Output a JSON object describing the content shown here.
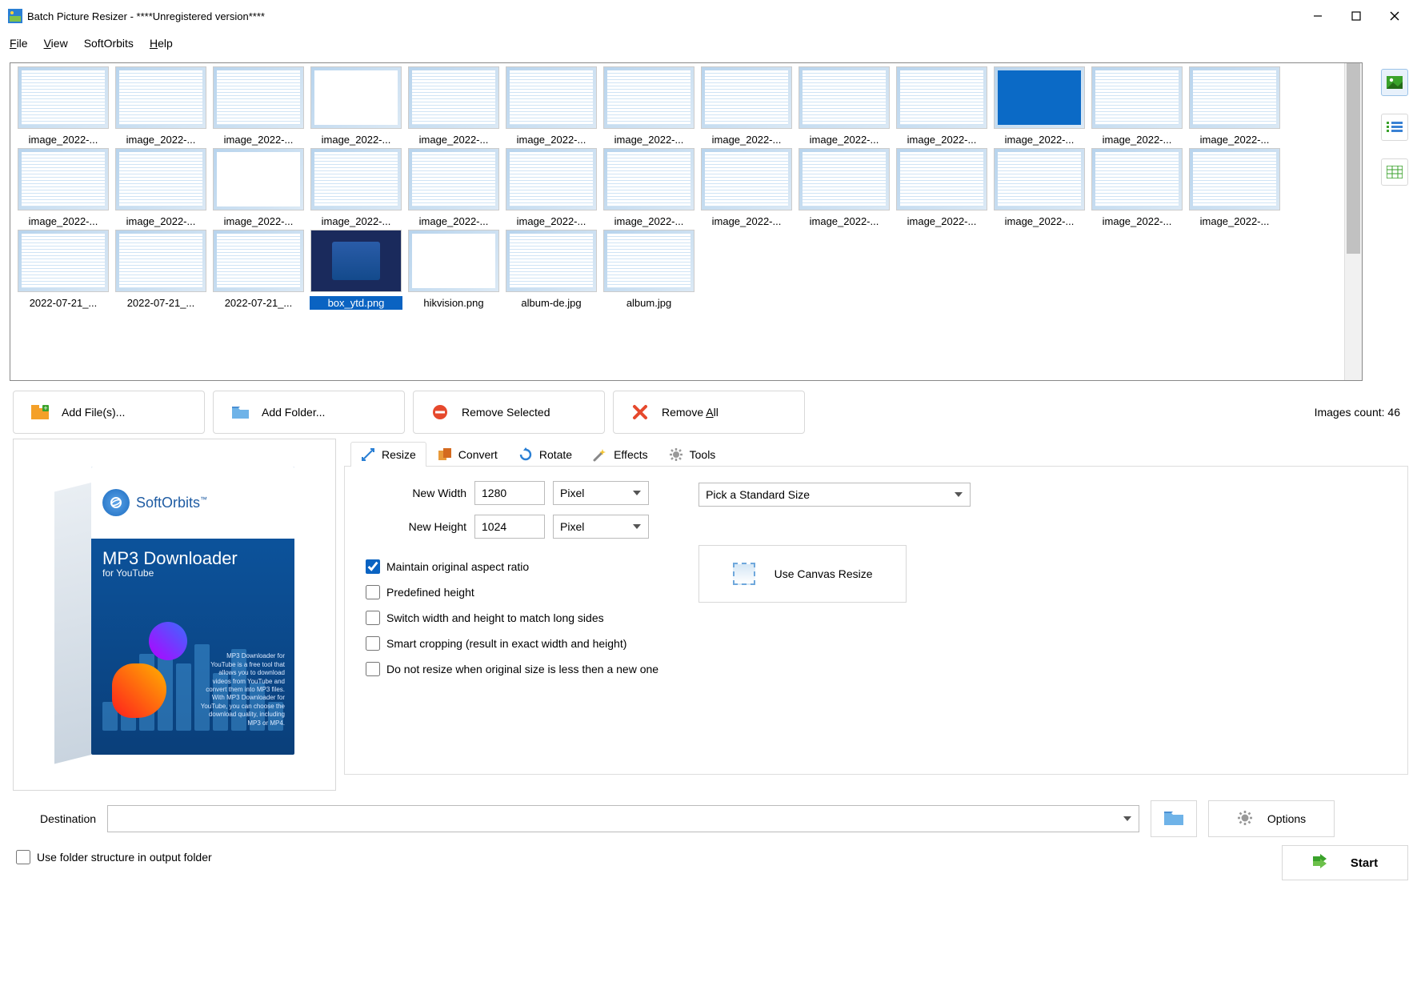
{
  "titlebar": {
    "title": "Batch Picture Resizer - ****Unregistered version****"
  },
  "menu": {
    "file": "File",
    "view": "View",
    "softorbits": "SoftOrbits",
    "help": "Help"
  },
  "thumbs": {
    "row": [
      {
        "label": "image_2022-...",
        "cls": ""
      },
      {
        "label": "image_2022-...",
        "cls": ""
      },
      {
        "label": "image_2022-...",
        "cls": ""
      },
      {
        "label": "image_2022-...",
        "cls": "doc"
      },
      {
        "label": "image_2022-...",
        "cls": ""
      },
      {
        "label": "image_2022-...",
        "cls": ""
      },
      {
        "label": "image_2022-...",
        "cls": ""
      },
      {
        "label": "image_2022-...",
        "cls": ""
      },
      {
        "label": "image_2022-...",
        "cls": ""
      },
      {
        "label": "image_2022-...",
        "cls": ""
      },
      {
        "label": "image_2022-...",
        "cls": "desktop"
      },
      {
        "label": "image_2022-...",
        "cls": ""
      },
      {
        "label": "image_2022-...",
        "cls": ""
      },
      {
        "label": "image_2022-...",
        "cls": ""
      },
      {
        "label": "image_2022-...",
        "cls": ""
      },
      {
        "label": "image_2022-...",
        "cls": "doc"
      },
      {
        "label": "image_2022-...",
        "cls": ""
      },
      {
        "label": "image_2022-...",
        "cls": ""
      },
      {
        "label": "image_2022-...",
        "cls": ""
      },
      {
        "label": "image_2022-...",
        "cls": ""
      },
      {
        "label": "image_2022-...",
        "cls": ""
      },
      {
        "label": "image_2022-...",
        "cls": ""
      },
      {
        "label": "image_2022-...",
        "cls": ""
      },
      {
        "label": "image_2022-...",
        "cls": ""
      },
      {
        "label": "image_2022-...",
        "cls": ""
      },
      {
        "label": "image_2022-...",
        "cls": ""
      },
      {
        "label": "2022-07-21_...",
        "cls": ""
      },
      {
        "label": "2022-07-21_...",
        "cls": ""
      },
      {
        "label": "2022-07-21_...",
        "cls": ""
      },
      {
        "label": "box_ytd.png",
        "cls": "box",
        "selected": true
      },
      {
        "label": "hikvision.png",
        "cls": "doc"
      },
      {
        "label": "album-de.jpg",
        "cls": ""
      },
      {
        "label": "album.jpg",
        "cls": ""
      }
    ]
  },
  "toolbar": {
    "add_files": "Add File(s)...",
    "add_folder": "Add Folder...",
    "remove_selected": "Remove Selected",
    "remove_all": "Remove All",
    "images_count": "Images count: 46"
  },
  "preview": {
    "brand": "SoftOrbits",
    "product": "MP3 Downloader",
    "sub": "for YouTube",
    "tiny": "MP3 Downloader for YouTube is a free tool that allows you to download videos from YouTube and convert them into MP3 files. With MP3 Downloader for YouTube, you can choose the download quality, including MP3 or MP4."
  },
  "tabs": {
    "resize": "Resize",
    "convert": "Convert",
    "rotate": "Rotate",
    "effects": "Effects",
    "tools": "Tools"
  },
  "resize": {
    "new_width_label": "New Width",
    "new_width": "1280",
    "new_height_label": "New Height",
    "new_height": "1024",
    "unit": "Pixel",
    "std_size": "Pick a Standard Size",
    "maintain": "Maintain original aspect ratio",
    "predef": "Predefined height",
    "switch": "Switch width and height to match long sides",
    "smart": "Smart cropping (result in exact width and height)",
    "noresize": "Do not resize when original size is less then a new one",
    "canvas": "Use Canvas Resize"
  },
  "dest": {
    "label": "Destination",
    "options": "Options",
    "use_folder": "Use folder structure in output folder"
  },
  "start": "Start"
}
